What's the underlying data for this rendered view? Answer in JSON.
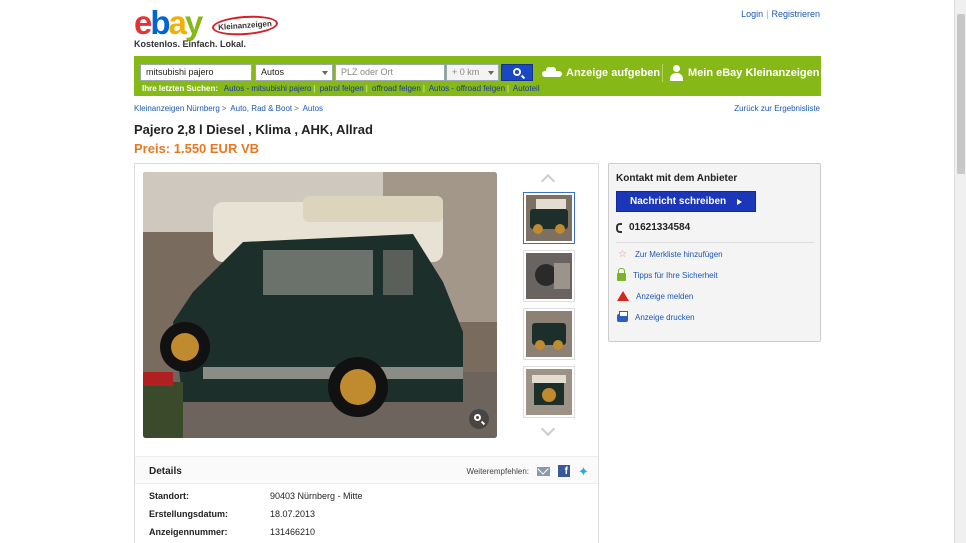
{
  "header": {
    "logo_ebay": "ebay",
    "logo_badge": "Kleinanzeigen",
    "tagline": "Kostenlos. Einfach. Lokal.",
    "login": "Login",
    "register": "Registrieren"
  },
  "search": {
    "query": "mitsubishi pajero",
    "category": "Autos",
    "location_placeholder": "PLZ oder Ort",
    "radius": "+ 0 km",
    "post_ad": "Anzeige aufgeben",
    "my_account": "Mein eBay Kleinanzeigen",
    "recent_label": "Ihre letzten Suchen:",
    "recent": [
      "Autos - mitsubishi pajero",
      "patrol felgen",
      "offroad felgen",
      "Autos - offroad felgen",
      "Autoteil"
    ]
  },
  "breadcrumb": [
    "Kleinanzeigen Nürnberg",
    "Auto, Rad & Boot",
    "Autos"
  ],
  "back_link": "Zurück zur Ergebnisliste",
  "listing": {
    "title": "Pajero 2,8 l Diesel , Klima , AHK, Allrad",
    "price": "Preis: 1.550 EUR VB"
  },
  "details": {
    "heading": "Details",
    "share_label": "Weiterempfehlen:",
    "rows": [
      {
        "key": "Standort:",
        "value": "90403 Nürnberg - Mitte"
      },
      {
        "key": "Erstellungsdatum:",
        "value": "18.07.2013"
      },
      {
        "key": "Anzeigennummer:",
        "value": "131466210"
      }
    ]
  },
  "contact": {
    "title": "Kontakt mit dem Anbieter",
    "message_button": "Nachricht schreiben",
    "phone": "01621334584",
    "actions": [
      "Zur Merkliste hinzufügen",
      "Tipps für Ihre Sicherheit",
      "Anzeige melden",
      "Anzeige drucken"
    ]
  },
  "colors": {
    "brand_green": "#86b817",
    "button_blue": "#1c36b9",
    "price_orange": "#e87722",
    "link_blue": "#1a56b8"
  }
}
